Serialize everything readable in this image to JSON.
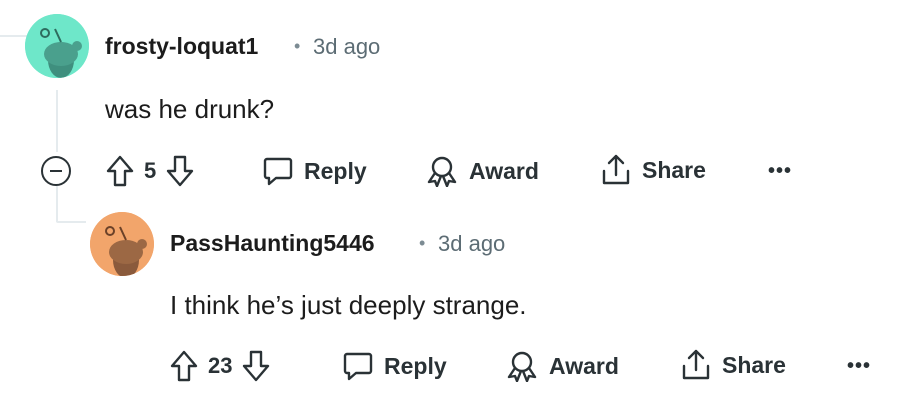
{
  "comments": [
    {
      "username": "frosty-loquat1",
      "separator": "•",
      "time": "3d ago",
      "body": "was he drunk?",
      "votes": "5",
      "reply_label": "Reply",
      "award_label": "Award",
      "share_label": "Share",
      "more_label": "•••",
      "avatar_color": "#6ee7c9"
    },
    {
      "username": "PassHaunting5446",
      "separator": "•",
      "time": "3d ago",
      "body": "I think he’s just deeply strange.",
      "votes": "23",
      "reply_label": "Reply",
      "award_label": "Award",
      "share_label": "Share",
      "more_label": "•••",
      "avatar_color": "#f2a56b"
    }
  ],
  "icons": {
    "upvote": "upvote-icon",
    "downvote": "downvote-icon",
    "reply": "speech-bubble-icon",
    "award": "award-ribbon-icon",
    "share": "share-upload-icon",
    "collapse": "collapse-minus-icon"
  }
}
